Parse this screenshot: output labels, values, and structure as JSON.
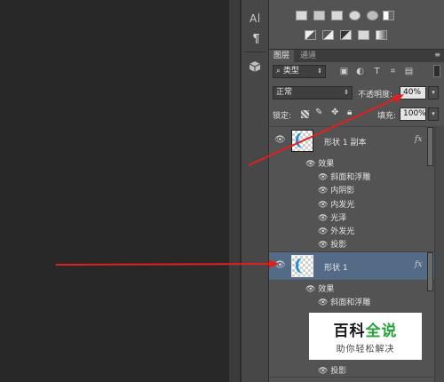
{
  "tool_strip": {
    "buttons": [
      {
        "name": "character-icon",
        "glyph": "A|"
      },
      {
        "name": "paragraph-icon",
        "glyph": "¶"
      },
      {
        "name": "3d-cube-icon",
        "glyph": "⬢"
      }
    ]
  },
  "adjustments": {
    "row1": [
      "levels-icon",
      "curves-icon",
      "exposure-icon",
      "hue-saturation-icon",
      "color-balance-icon",
      "black-white-icon"
    ],
    "row2": [
      "invert-icon",
      "posterize-icon",
      "threshold-icon",
      "selective-color-icon",
      "gradient-map-icon"
    ]
  },
  "layers_panel": {
    "tabs": [
      {
        "label": "图层",
        "active": true
      },
      {
        "label": "通道",
        "active": false
      }
    ],
    "filter": {
      "kind_label": "类型",
      "icons": [
        "pixel-filter-icon",
        "adjustment-filter-icon",
        "type-filter-icon",
        "shape-filter-icon",
        "smart-object-filter-icon"
      ]
    },
    "blend_mode": "正常",
    "opacity_label": "不透明度:",
    "opacity_value": "40%",
    "lock_label": "锁定:",
    "fill_label": "填充:",
    "fill_value": "100%",
    "layers": [
      {
        "name": "形状 1 副本",
        "fx": "fx",
        "selected": false,
        "effects_label": "效果",
        "effects": [
          "斜面和浮雕",
          "内阴影",
          "内发光",
          "光泽",
          "外发光",
          "投影"
        ]
      },
      {
        "name": "形状 1",
        "fx": "fx",
        "selected": true,
        "effects_label": "效果",
        "effects": [
          "斜面和浮雕",
          "投影"
        ]
      }
    ]
  },
  "annotations": {
    "arrow_color": "#e02020"
  },
  "watermark": {
    "title_a": "百科",
    "title_b": "全说",
    "subtitle": "助你轻松解决"
  }
}
